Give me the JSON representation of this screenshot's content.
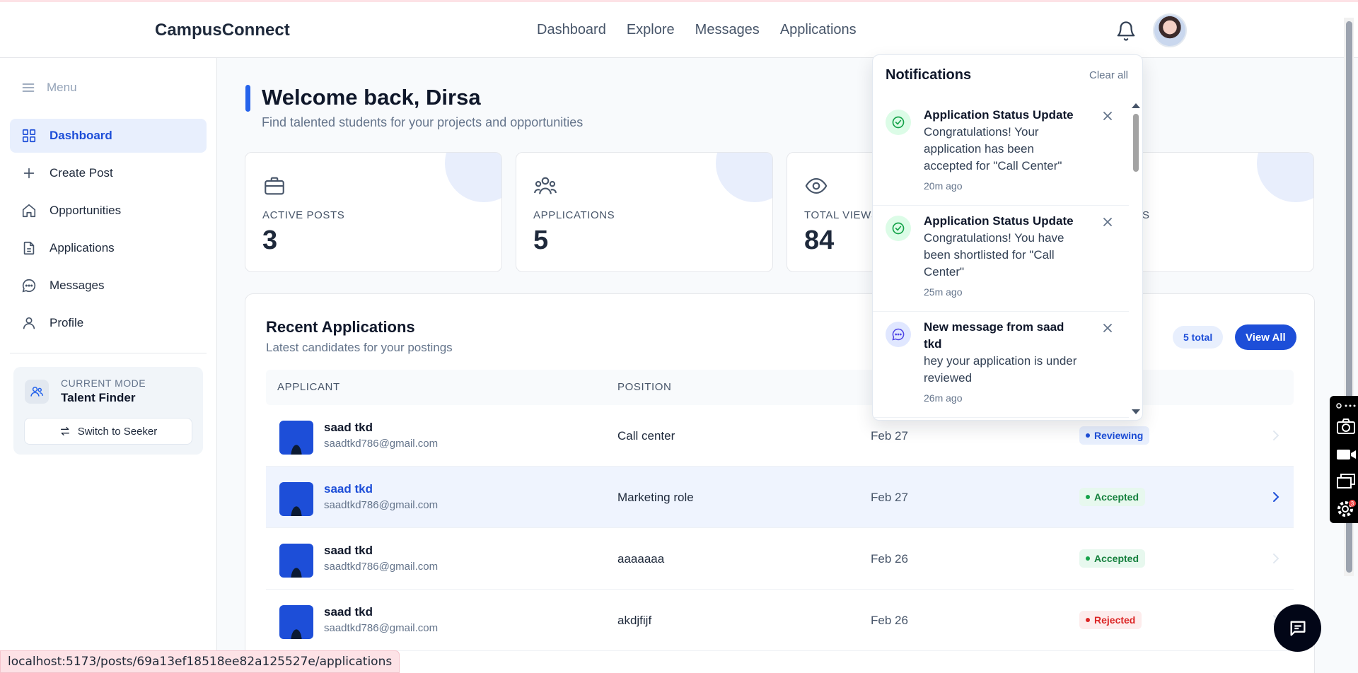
{
  "app": {
    "brand": "CampusConnect"
  },
  "topnav": {
    "links": [
      "Dashboard",
      "Explore",
      "Messages",
      "Applications"
    ]
  },
  "sidebar": {
    "menu_label": "Menu",
    "items": [
      {
        "label": "Dashboard",
        "icon": "grid-icon",
        "active": true
      },
      {
        "label": "Create Post",
        "icon": "plus-icon"
      },
      {
        "label": "Opportunities",
        "icon": "home-icon"
      },
      {
        "label": "Applications",
        "icon": "document-icon"
      },
      {
        "label": "Messages",
        "icon": "chat-bubble-icon"
      },
      {
        "label": "Profile",
        "icon": "user-icon"
      }
    ],
    "mode": {
      "label": "CURRENT MODE",
      "value": "Talent Finder",
      "switch_label": "Switch to Seeker"
    }
  },
  "main": {
    "welcome": "Welcome back, Dirsa",
    "subtitle": "Find talented students for your projects and opportunities",
    "stats": [
      {
        "label": "ACTIVE POSTS",
        "value": "3",
        "icon": "briefcase-icon"
      },
      {
        "label": "APPLICATIONS",
        "value": "5",
        "icon": "users-icon"
      },
      {
        "label": "TOTAL VIEWS",
        "value": "84",
        "icon": "eye-icon"
      },
      {
        "label": "S",
        "value": ""
      }
    ],
    "recent": {
      "title": "Recent Applications",
      "subtitle": "Latest candidates for your postings",
      "total_badge": "5 total",
      "view_all": "View All",
      "columns": [
        "APPLICANT",
        "POSITION"
      ],
      "rows": [
        {
          "name": "saad tkd",
          "email": "saadtkd786@gmail.com",
          "position": "Call center",
          "date": "Feb 27",
          "status": "Reviewing"
        },
        {
          "name": "saad tkd",
          "email": "saadtkd786@gmail.com",
          "position": "Marketing role",
          "date": "Feb 27",
          "status": "Accepted"
        },
        {
          "name": "saad tkd",
          "email": "saadtkd786@gmail.com",
          "position": "aaaaaaa",
          "date": "Feb 26",
          "status": "Accepted"
        },
        {
          "name": "saad tkd",
          "email": "saadtkd786@gmail.com",
          "position": "akdjfijf",
          "date": "Feb 26",
          "status": "Rejected"
        }
      ]
    }
  },
  "notifications": {
    "title": "Notifications",
    "clear_all": "Clear all",
    "items": [
      {
        "title": "Application Status Update",
        "body": "Congratulations! Your application has been accepted for \"Call Center\"",
        "time": "20m ago",
        "icon": "check-circle-icon"
      },
      {
        "title": "Application Status Update",
        "body": "Congratulations! You have been shortlisted for \"Call Center\"",
        "time": "25m ago",
        "icon": "check-circle-icon"
      },
      {
        "title": "New message from saad tkd",
        "body": "hey your application is under reviewed",
        "time": "26m ago",
        "icon": "chat-bubble-icon"
      }
    ]
  },
  "status_colors": {
    "Reviewing": {
      "bg": "#e8effd",
      "fg": "#1d4ed8"
    },
    "Accepted": {
      "bg": "#e7f8ee",
      "fg": "#15803d"
    },
    "Rejected": {
      "bg": "#fdecec",
      "fg": "#dc2626"
    }
  },
  "browser": {
    "status_url": "localhost:5173/posts/69a13ef18518ee82a125527e/applications"
  },
  "overlay_badge": "3"
}
